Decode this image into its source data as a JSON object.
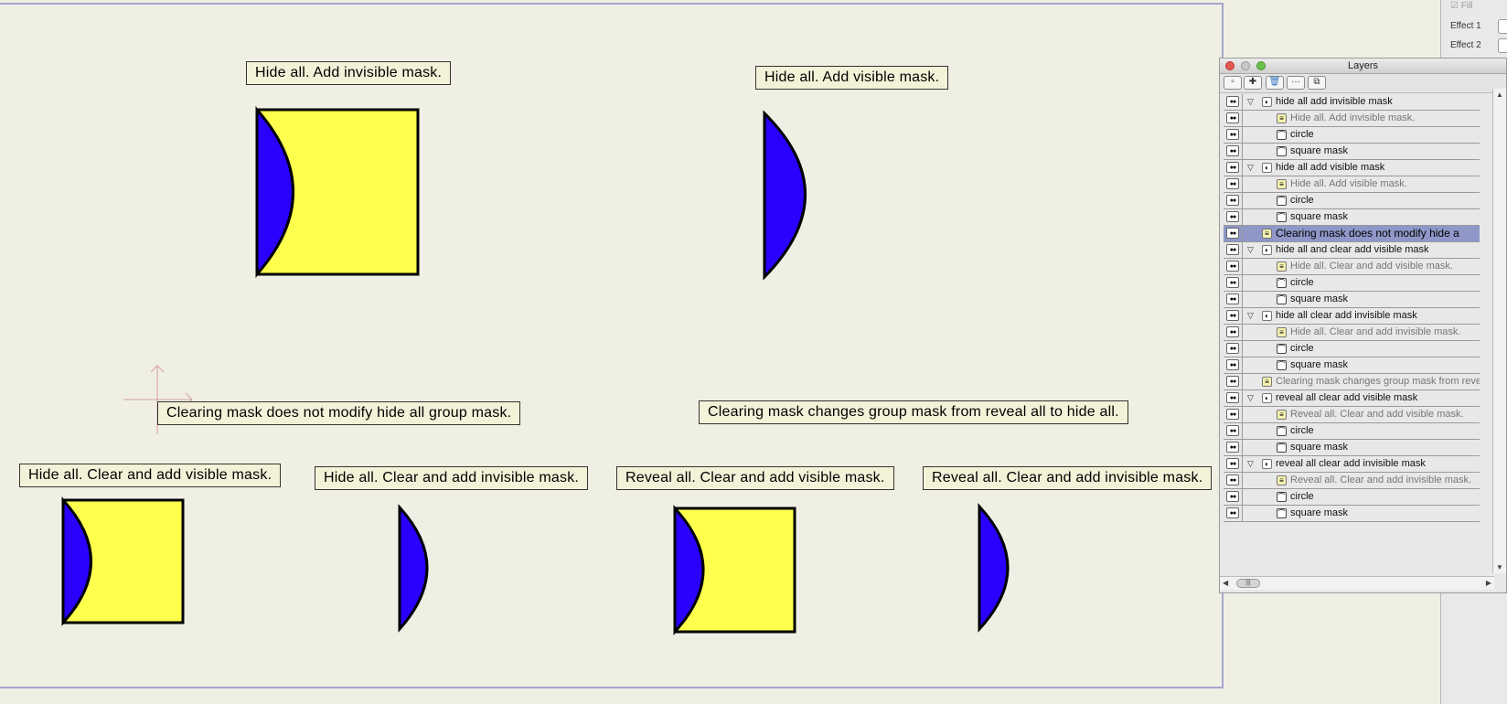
{
  "canvas": {
    "labels": {
      "top_left": "Hide all. Add invisible mask.",
      "top_right": "Hide all. Add visible mask.",
      "mid_left": "Clearing mask does not modify hide all group mask.",
      "mid_right": "Clearing mask changes group mask from reveal all to hide all.",
      "b1": "Hide all. Clear and add visible mask.",
      "b2": "Hide all. Clear and add invisible mask.",
      "b3": "Reveal all. Clear and add visible mask.",
      "b4": "Reveal all. Clear and add invisible mask."
    },
    "colors": {
      "fill_yellow": "#ffff4d",
      "fill_blue": "#2a00ff",
      "stroke": "#000000",
      "canvas_bg": "#f0efe4"
    }
  },
  "side_panel": {
    "fill_label": "Fill",
    "effect1": "Effect 1",
    "effect2": "Effect 2"
  },
  "layers": {
    "title": "Layers",
    "toolbar_icons": [
      "new-layer-icon",
      "add-group-icon",
      "trash-icon",
      "more-icon",
      "duplicate-icon"
    ],
    "more_glyph": "···",
    "rows": [
      {
        "label": "hide all add invisible mask",
        "kind": "group",
        "level": 0
      },
      {
        "label": "Hide all. Add invisible mask.",
        "kind": "text",
        "level": 1,
        "note": true
      },
      {
        "label": "circle",
        "kind": "shape",
        "level": 1
      },
      {
        "label": "square mask",
        "kind": "shape",
        "level": 1
      },
      {
        "label": "hide all add visible mask",
        "kind": "group",
        "level": 0
      },
      {
        "label": "Hide all. Add visible mask.",
        "kind": "text",
        "level": 1,
        "note": true
      },
      {
        "label": "circle",
        "kind": "shape",
        "level": 1
      },
      {
        "label": "square mask",
        "kind": "shape",
        "level": 1
      },
      {
        "label": "Clearing mask does not modify hide a",
        "kind": "text",
        "level": 0,
        "selected": true
      },
      {
        "label": "hide all and clear add visible mask",
        "kind": "group",
        "level": 0
      },
      {
        "label": "Hide all. Clear and add visible mask.",
        "kind": "text",
        "level": 1,
        "note": true
      },
      {
        "label": "circle",
        "kind": "shape",
        "level": 1
      },
      {
        "label": "square mask",
        "kind": "shape",
        "level": 1
      },
      {
        "label": "hide all clear add invisible mask",
        "kind": "group",
        "level": 0
      },
      {
        "label": "Hide all. Clear and add invisible mask.",
        "kind": "text",
        "level": 1,
        "note": true
      },
      {
        "label": "circle",
        "kind": "shape",
        "level": 1
      },
      {
        "label": "square mask",
        "kind": "shape",
        "level": 1
      },
      {
        "label": "Clearing mask changes group mask from revea",
        "kind": "text",
        "level": 0,
        "note": true
      },
      {
        "label": "reveal all clear add visible mask",
        "kind": "group",
        "level": 0
      },
      {
        "label": "Reveal all. Clear and add visible mask.",
        "kind": "text",
        "level": 1,
        "note": true
      },
      {
        "label": "circle",
        "kind": "shape",
        "level": 1
      },
      {
        "label": "square mask",
        "kind": "shape",
        "level": 1
      },
      {
        "label": "reveal all clear add invisible mask",
        "kind": "group",
        "level": 0
      },
      {
        "label": "Reveal all. Clear and add invisible mask.",
        "kind": "text",
        "level": 1,
        "note": true
      },
      {
        "label": "circle",
        "kind": "shape",
        "level": 1
      },
      {
        "label": "square mask",
        "kind": "shape",
        "level": 1
      }
    ]
  }
}
